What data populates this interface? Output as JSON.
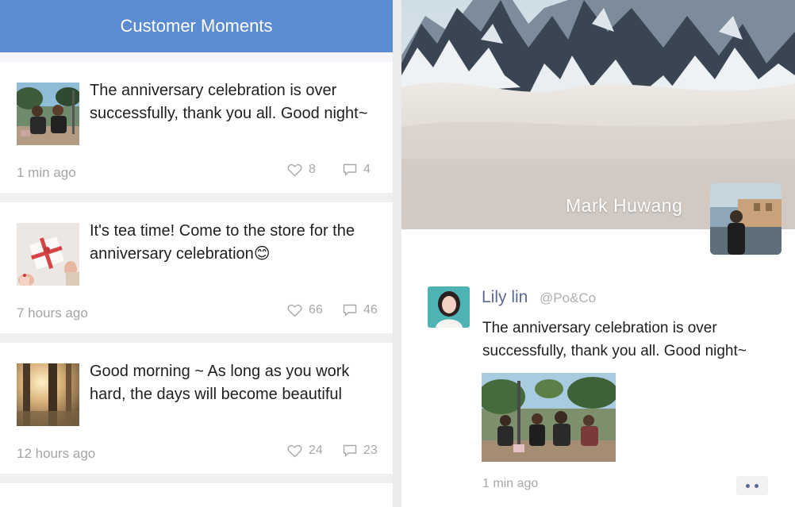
{
  "header": {
    "title": "Customer Moments"
  },
  "moments": [
    {
      "text": "The anniversary celebration is over successfully, thank you all. Good night~",
      "time": "1 min ago",
      "likes": "8",
      "comments": "4"
    },
    {
      "text": "It's tea time! Come to the store for the anniversary celebration😊",
      "time": "7 hours ago",
      "likes": "66",
      "comments": "46"
    },
    {
      "text": "Good morning ~ As long as you work hard, the days will become beautiful",
      "time": "12 hours ago",
      "likes": "24",
      "comments": "23"
    }
  ],
  "profile": {
    "name": "Mark Huwang"
  },
  "post": {
    "author": "Lily lin",
    "handle": "@Po&Co",
    "text": "The anniversary celebration is over successfully, thank you all. Good night~",
    "time": "1 min ago"
  },
  "colors": {
    "header": "#5b8bd1",
    "author": "#5a6b93"
  },
  "icons": {
    "like": "heart-icon",
    "comment": "comment-icon",
    "more": "more-dots-icon"
  }
}
